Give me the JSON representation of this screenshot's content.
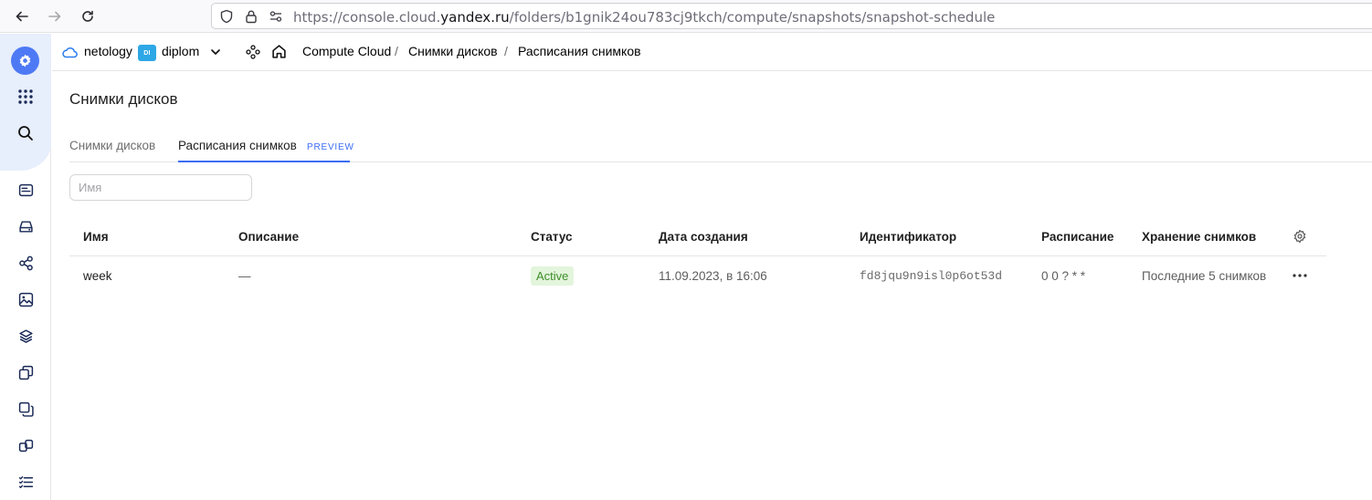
{
  "browser": {
    "url_prefix": "https://console.cloud.",
    "url_domain": "yandex.ru",
    "url_path": "/folders/b1gnik24ou783cj9tkch/compute/snapshots/snapshot-schedule"
  },
  "header": {
    "cloud_name": "netology",
    "folder_badge": "DI",
    "folder_name": "diplom",
    "breadcrumbs": [
      "Compute Cloud",
      "Снимки дисков",
      "Расписания снимков"
    ],
    "separator": "/"
  },
  "page": {
    "title": "Снимки дисков",
    "tabs": [
      {
        "label": "Снимки дисков",
        "active": false
      },
      {
        "label": "Расписания снимков",
        "active": true,
        "badge": "PREVIEW"
      }
    ],
    "search_placeholder": "Имя"
  },
  "table": {
    "columns": [
      "Имя",
      "Описание",
      "Статус",
      "Дата создания",
      "Идентификатор",
      "Расписание",
      "Хранение снимков"
    ],
    "rows": [
      {
        "name": "week",
        "description": "—",
        "status": "Active",
        "created": "11.09.2023, в 16:06",
        "id": "fd8jqu9n9isl0p6ot53d",
        "schedule": "0 0 ? * *",
        "retention": "Последние 5 снимков"
      }
    ]
  },
  "colors": {
    "accent": "#3b6df5",
    "status_active_bg": "#e3f5dc",
    "status_active_text": "#3e8e2a",
    "folder_badge": "#2ea7e6"
  },
  "icons": {
    "rail": [
      "settings-icon",
      "apps-grid-icon",
      "search-icon",
      "dashboard-icon",
      "disk-icon",
      "network-icon",
      "image-icon",
      "layers-icon",
      "snapshot-icon",
      "copy-icon",
      "instance-groups-icon",
      "tasks-icon"
    ]
  }
}
